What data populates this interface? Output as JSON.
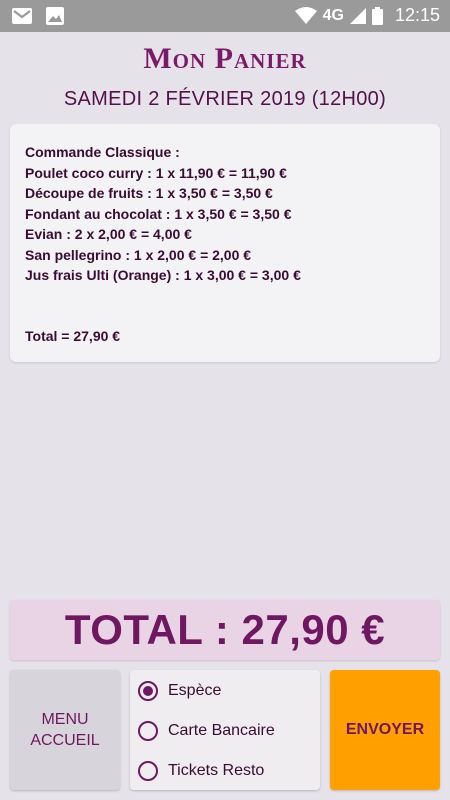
{
  "status_bar": {
    "icons": [
      "gmail-icon",
      "image-icon",
      "wifi-icon",
      "signal-icon",
      "battery-icon"
    ],
    "network": "4G",
    "time": "12:15"
  },
  "header": {
    "title": "Mon Panier",
    "date": "SAMEDI 2 FÉVRIER 2019 (12H00)"
  },
  "order": {
    "heading": "Commande Classique :",
    "lines": [
      "Poulet coco curry : 1 x 11,90 € = 11,90 €",
      "Découpe de fruits : 1 x 3,50 € = 3,50 €",
      "Fondant au chocolat : 1 x 3,50 € = 3,50 €",
      "Evian : 2 x 2,00 € = 4,00 €",
      "San pellegrino : 1 x 2,00 € = 2,00 €",
      "Jus frais Ulti (Orange) : 1 x 3,00 € = 3,00 €"
    ],
    "total_line": "Total = 27,90 €"
  },
  "total_banner": "TOTAL : 27,90 €",
  "menu_button": {
    "line1": "MENU",
    "line2": "ACCUEIL"
  },
  "payment": {
    "options": [
      {
        "label": "Espèce",
        "selected": true
      },
      {
        "label": "Carte Bancaire",
        "selected": false
      },
      {
        "label": "Tickets Resto",
        "selected": false
      }
    ]
  },
  "send_button": "ENVOYER",
  "colors": {
    "accent": "#6f1760",
    "background": "#e6e2ea",
    "send": "#ffa000",
    "total_box": "#e8d4e4"
  }
}
